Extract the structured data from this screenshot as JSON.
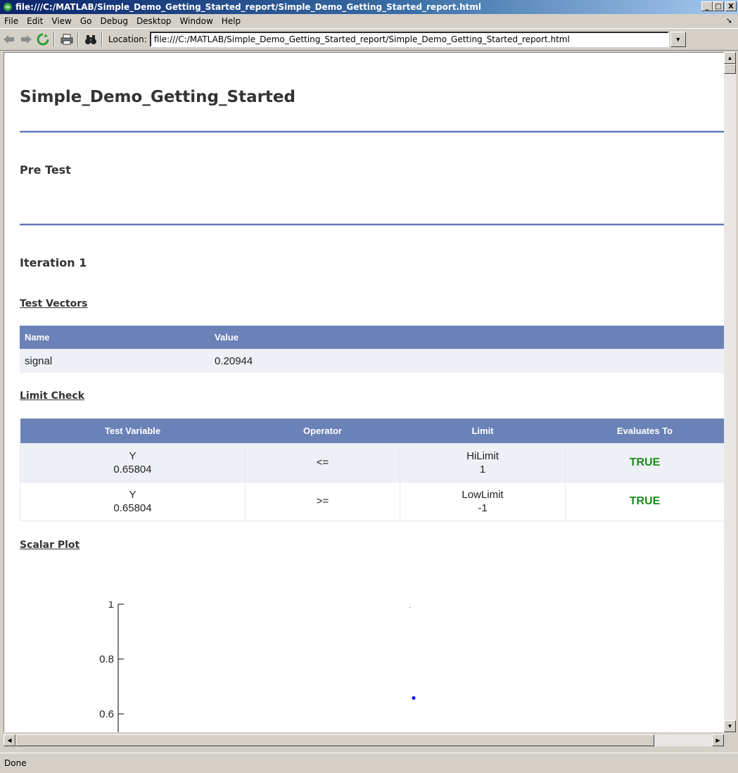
{
  "window": {
    "title": "file:///C:/MATLAB/Simple_Demo_Getting_Started_report/Simple_Demo_Getting_Started_report.html",
    "minimize": "_",
    "maximize": "□",
    "close": "X"
  },
  "menu": [
    "File",
    "Edit",
    "View",
    "Go",
    "Debug",
    "Desktop",
    "Window",
    "Help"
  ],
  "toolbar": {
    "location_label": "Location:",
    "location_value": "file:///C:/MATLAB/Simple_Demo_Getting_Started_report/Simple_Demo_Getting_Started_report.html"
  },
  "report": {
    "title": "Simple_Demo_Getting_Started",
    "pre_test": "Pre Test",
    "iteration": "Iteration 1",
    "test_vectors": {
      "heading": "Test Vectors",
      "columns": [
        "Name",
        "Value"
      ],
      "rows": [
        [
          "signal",
          "0.20944"
        ]
      ]
    },
    "limit_check": {
      "heading": "Limit Check",
      "columns": [
        "Test Variable",
        "Operator",
        "Limit",
        "Evaluates To"
      ],
      "rows": [
        {
          "var_name": "Y",
          "var_value": "0.65804",
          "operator": "<=",
          "limit_name": "HiLimit",
          "limit_value": "1",
          "result": "TRUE"
        },
        {
          "var_name": "Y",
          "var_value": "0.65804",
          "operator": ">=",
          "limit_name": "LowLimit",
          "limit_value": "-1",
          "result": "TRUE"
        }
      ]
    },
    "scalar_plot": {
      "heading": "Scalar Plot",
      "y_ticks": [
        "1",
        "0.8",
        "0.6"
      ],
      "point_value": 0.65804,
      "point_color": "#0000ff"
    }
  },
  "status": "Done",
  "colors": {
    "header_bg": "#6b82b8",
    "rule": "#6178b6",
    "true_text": "#1e8a1e"
  }
}
